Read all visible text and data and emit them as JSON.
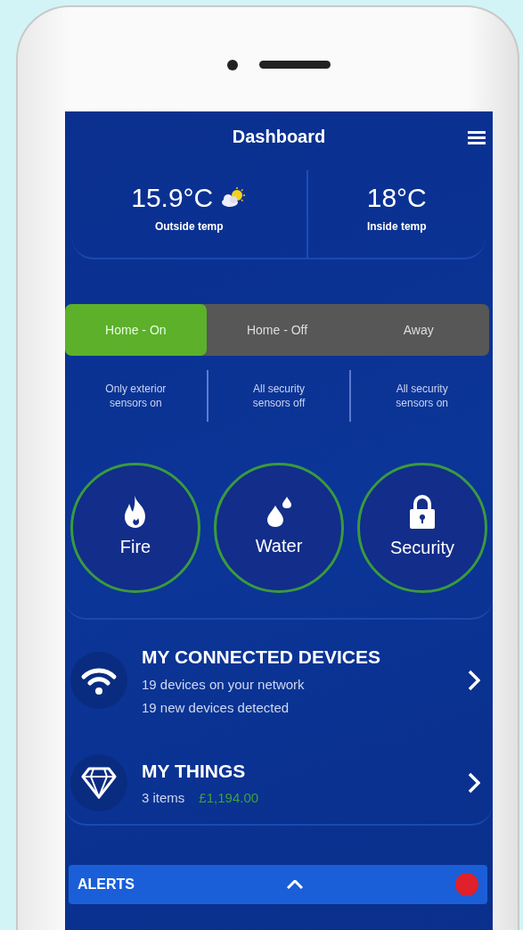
{
  "header": {
    "title": "Dashboard"
  },
  "temperatures": [
    {
      "value": "15.9°C",
      "label": "Outside temp",
      "kind": "weather"
    },
    {
      "value": "18°C",
      "label": "Inside temp",
      "kind": "plain"
    }
  ],
  "modes": [
    {
      "label": "Home - On",
      "selected": true,
      "description": "Only exterior sensors on"
    },
    {
      "label": "Home - Off",
      "selected": false,
      "description": "All security sensors off"
    },
    {
      "label": "Away",
      "selected": false,
      "description": "All security sensors on"
    }
  ],
  "categories": [
    {
      "label": "Fire",
      "kind": "fire"
    },
    {
      "label": "Water",
      "kind": "water"
    },
    {
      "label": "Security",
      "kind": "lock"
    }
  ],
  "rows": [
    {
      "kind": "wifi",
      "title": "MY CONNECTED DEVICES",
      "lines": [
        "19 devices on your network",
        "19 new devices detected"
      ]
    },
    {
      "kind": "diamond",
      "title": "MY THINGS",
      "lines": [
        "3 items"
      ],
      "value": "£1,194.00"
    }
  ],
  "alerts": {
    "title": "ALERTS"
  }
}
